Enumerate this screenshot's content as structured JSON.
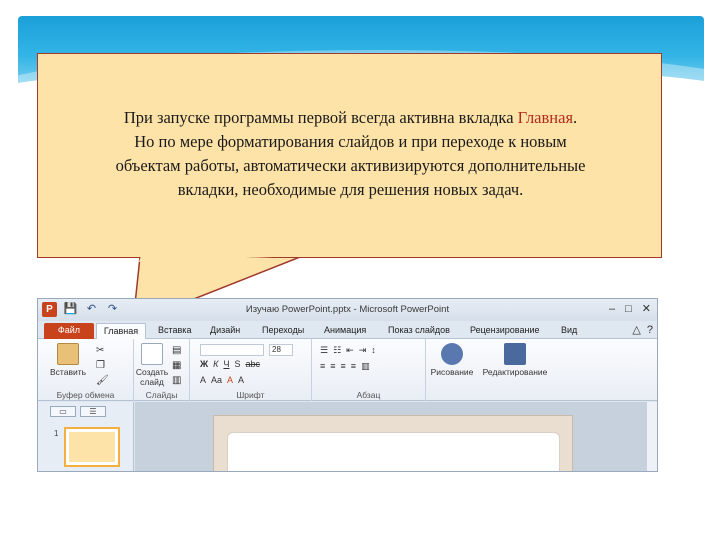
{
  "callout": {
    "line1_pre": "При запуске программы первой всегда активна вкладка ",
    "line1_highlight": "Главная",
    "line1_post": ".",
    "line2": "Но по мере форматирования слайдов и при переходе к новым",
    "line3": "объектам  работы, автоматически активизируются дополнительные",
    "line4": "вкладки, необходимые для решения новых задач."
  },
  "window": {
    "title": "Изучаю PowerPoint.pptx - Microsoft PowerPoint",
    "minimize": "–",
    "maximize": "□",
    "close": "✕"
  },
  "quick_access": [
    "P",
    "💾",
    "↶",
    "↷"
  ],
  "tabs": {
    "file": "Файл",
    "home": "Главная",
    "insert": "Вставка",
    "design": "Дизайн",
    "transitions": "Переходы",
    "animations": "Анимация",
    "slideshow": "Показ слайдов",
    "review": "Рецензирование",
    "view": "Вид"
  },
  "help": {
    "collapse": "△",
    "help": "?"
  },
  "ribbon": {
    "paste_label": "Вставить",
    "clipboard_group": "Буфер обмена",
    "new_slide_label": "Создать слайд",
    "slides_group": "Слайды",
    "font_group": "Шрифт",
    "font_size": "28",
    "font_buttons": [
      "Ж",
      "К",
      "Ч",
      "S",
      "abc",
      "A",
      "Aa",
      "A",
      "A"
    ],
    "paragraph_group": "Абзац",
    "drawing_label": "Рисование",
    "editing_label": "Редактирование"
  },
  "slide_panel": {
    "tab_slides": "▭",
    "tab_outline": "☰",
    "slide_number": "1"
  },
  "colors": {
    "callout_bg": "#fde3a8",
    "callout_border": "#a23a2a",
    "highlight": "#b22a1a",
    "file_tab": "#c8421c",
    "banner": "#1aa0d8"
  }
}
